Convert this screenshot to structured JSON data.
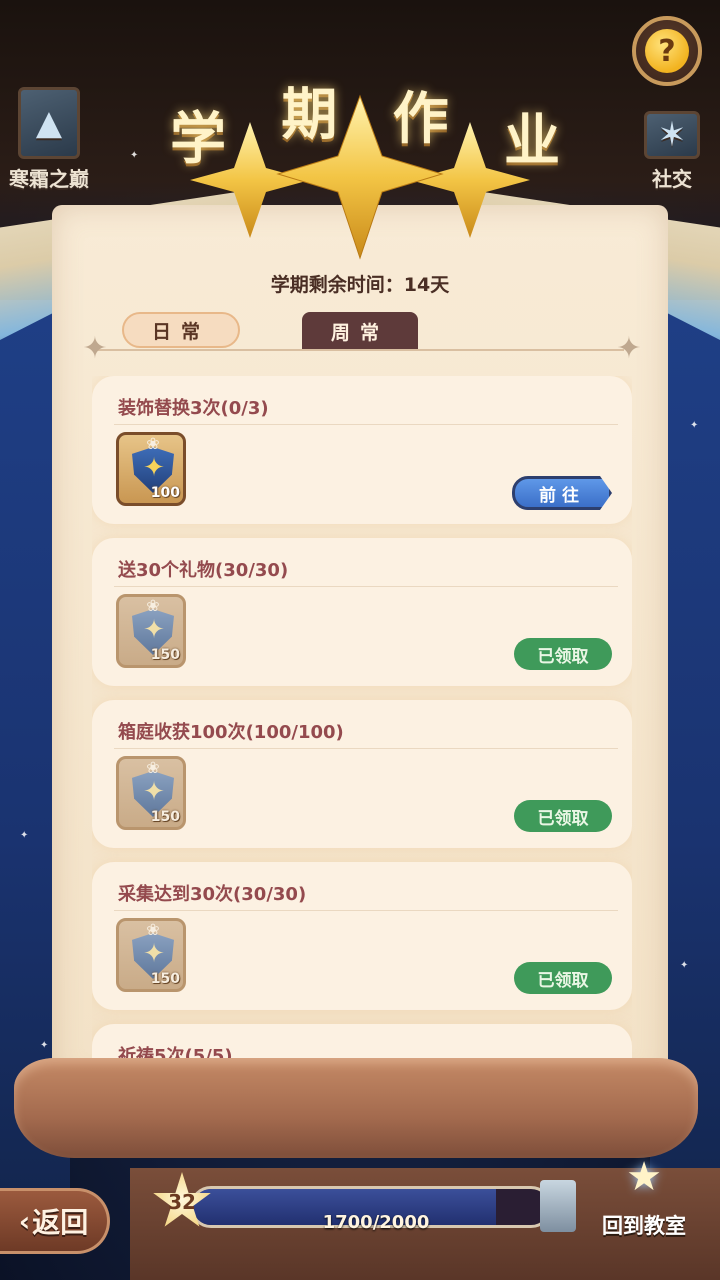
{
  "header": {
    "title_chars": [
      "学",
      "期",
      "作",
      "业"
    ],
    "help_icon": "question-mark-icon",
    "side_left_label": "寒霜之巅",
    "side_right_label": "社交"
  },
  "panel": {
    "remaining_time": "学期剩余时间：14天",
    "tabs": [
      {
        "label": "日常",
        "active": false
      },
      {
        "label": "周常",
        "active": true
      }
    ]
  },
  "tasks": [
    {
      "title": "装饰替换3次(0/3)",
      "reward_amount": "100",
      "status": "go",
      "button_label": "前往"
    },
    {
      "title": "送30个礼物(30/30)",
      "reward_amount": "150",
      "status": "claimed",
      "button_label": "已领取"
    },
    {
      "title": "箱庭收获100次(100/100)",
      "reward_amount": "150",
      "status": "claimed",
      "button_label": "已领取"
    },
    {
      "title": "采集达到30次(30/30)",
      "reward_amount": "150",
      "status": "claimed",
      "button_label": "已领取"
    },
    {
      "title": "祈祷5次(5/5)",
      "reward_amount": "",
      "status": "",
      "button_label": ""
    }
  ],
  "footer": {
    "back_label": "返回",
    "level": "32",
    "progress_text": "1700/2000",
    "progress_fraction": 0.85,
    "classroom_label": "回到教室"
  },
  "colors": {
    "go_button": "#3b6fc8",
    "claimed_button": "#3f9a5a",
    "task_title": "#944a4e"
  }
}
